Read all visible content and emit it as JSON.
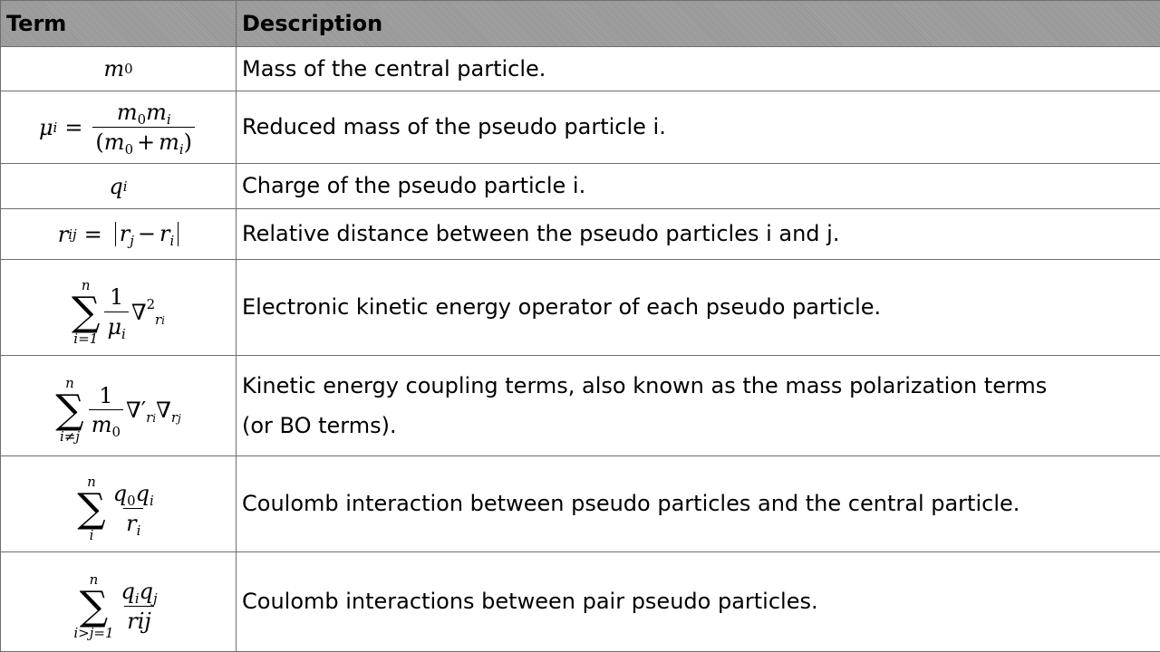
{
  "table": {
    "headers": {
      "term": "Term",
      "description": "Description"
    },
    "rows": [
      {
        "term_text": "m0",
        "description": "Mass of the central particle."
      },
      {
        "term_text": "μi = m0mi / (m0 + mi)",
        "description": "Reduced mass of the pseudo particle i."
      },
      {
        "term_text": "qi",
        "description": "Charge of the pseudo particle i."
      },
      {
        "term_text": "rij = |rj − ri|",
        "description": "Relative distance between the pseudo particles i and j."
      },
      {
        "term_text": "Σ(i=1..n) 1/μi ∇²ri",
        "description": "Electronic kinetic energy operator of each pseudo particle."
      },
      {
        "term_text": "Σ(i≠j, n) 1/m0 ∇′ri ∇rj",
        "description": "Kinetic energy coupling terms, also known as the mass polarization terms (or BO terms)."
      },
      {
        "term_text": "Σ(i, n) q0qi / ri",
        "description": "Coulomb interaction between pseudo particles and the central particle."
      },
      {
        "term_text": "Σ(i>j=1, n) qiqj / rij",
        "description": "Coulomb interactions between pair pseudo particles."
      }
    ]
  }
}
